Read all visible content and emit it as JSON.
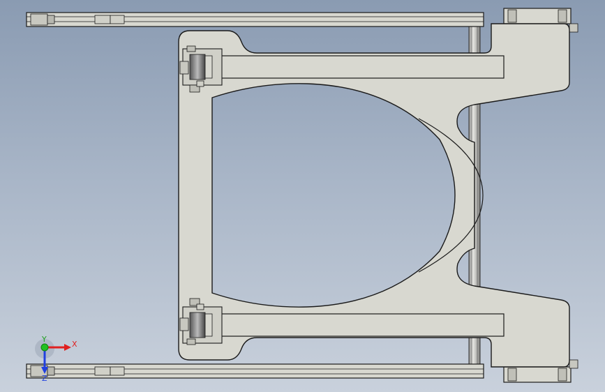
{
  "viewport": {
    "background_top": "#8a9bb2",
    "background_bottom": "#c9d1dc"
  },
  "model": {
    "part_fill": "#d8d8d0",
    "part_edge": "#1a1a1a",
    "shaft_fill": "#c4c4c0"
  },
  "triad": {
    "x_label": "X",
    "y_label": "Y",
    "z_label": "Z",
    "x_color": "#e02020",
    "y_color": "#20c020",
    "z_color": "#2040e0"
  }
}
